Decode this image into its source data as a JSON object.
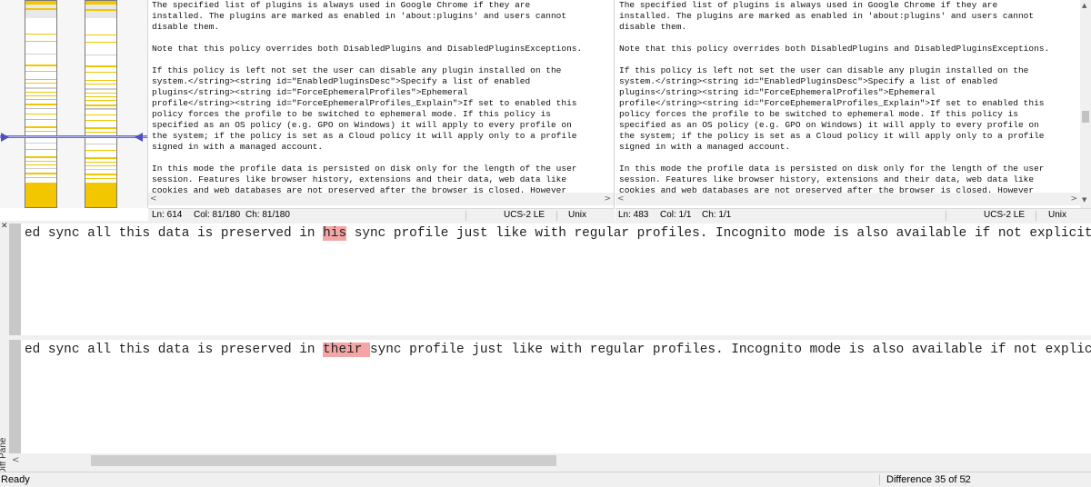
{
  "left_file": {
    "lines": [
      "The specified list of plugins is always used in Google Chrome if they are",
      "installed. The plugins are marked as enabled in 'about:plugins' and users cannot",
      "disable them.",
      "",
      "Note that this policy overrides both DisabledPlugins and DisabledPluginsExceptions.",
      "",
      "If this policy is left not set the user can disable any plugin installed on the",
      "system.</string><string id=\"EnabledPluginsDesc\">Specify a list of enabled",
      "plugins</string><string id=\"ForceEphemeralProfiles\">Ephemeral",
      "profile</string><string id=\"ForceEphemeralProfiles_Explain\">If set to enabled this",
      "policy forces the profile to be switched to ephemeral mode. If this policy is",
      "specified as an OS policy (e.g. GPO on Windows) it will apply to every profile on",
      "the system; if the policy is set as a Cloud policy it will apply only to a profile",
      "signed in with a managed account.",
      "",
      "In this mode the profile data is persisted on disk only for the length of the user",
      "session. Features like browser history, extensions and their data, web data like",
      "cookies and web databases are not preserved after the browser is closed. However"
    ],
    "status": {
      "ln": "Ln: 614",
      "col": "Col: 81/180",
      "ch": "Ch: 81/180",
      "encoding": "UCS-2 LE",
      "eol": "Unix"
    }
  },
  "right_file": {
    "lines": [
      "The specified list of plugins is always used in Google Chrome if they are",
      "installed. The plugins are marked as enabled in 'about:plugins' and users cannot",
      "disable them.",
      "",
      "Note that this policy overrides both DisabledPlugins and DisabledPluginsExceptions.",
      "",
      "If this policy is left not set the user can disable any plugin installed on the",
      "system.</string><string id=\"EnabledPluginsDesc\">Specify a list of enabled",
      "plugins</string><string id=\"ForceEphemeralProfiles\">Ephemeral",
      "profile</string><string id=\"ForceEphemeralProfiles_Explain\">If set to enabled this",
      "policy forces the profile to be switched to ephemeral mode. If this policy is",
      "specified as an OS policy (e.g. GPO on Windows) it will apply to every profile on",
      "the system; if the policy is set as a Cloud policy it will apply only to a profile",
      "signed in with a managed account.",
      "",
      "In this mode the profile data is persisted on disk only for the length of the user",
      "session. Features like browser history, extensions and their data, web data like",
      "cookies and web databases are not preserved after the browser is closed. However"
    ],
    "status": {
      "ln": "Ln: 483",
      "col": "Col: 1/1",
      "ch": "Ch: 1/1",
      "encoding": "UCS-2 LE",
      "eol": "Unix"
    }
  },
  "diff_pane": {
    "label": "Diff Pane",
    "top": {
      "before": "ed sync all this data is preserved in ",
      "changed": "his",
      "after": " sync profile just like with regular profiles. Incognito mode is also available if not explicitly"
    },
    "bottom": {
      "before": "ed sync all this data is preserved in ",
      "changed": "their ",
      "after": "sync profile just like with regular profiles. Incognito mode is also available if not explicit"
    }
  },
  "statusbar": {
    "ready": "Ready",
    "difference": "Difference 35 of 52"
  },
  "colors": {
    "diff_highlight": "#f4a6a6",
    "overview_change": "#f2c700",
    "overview_marker": "#5050c0"
  }
}
